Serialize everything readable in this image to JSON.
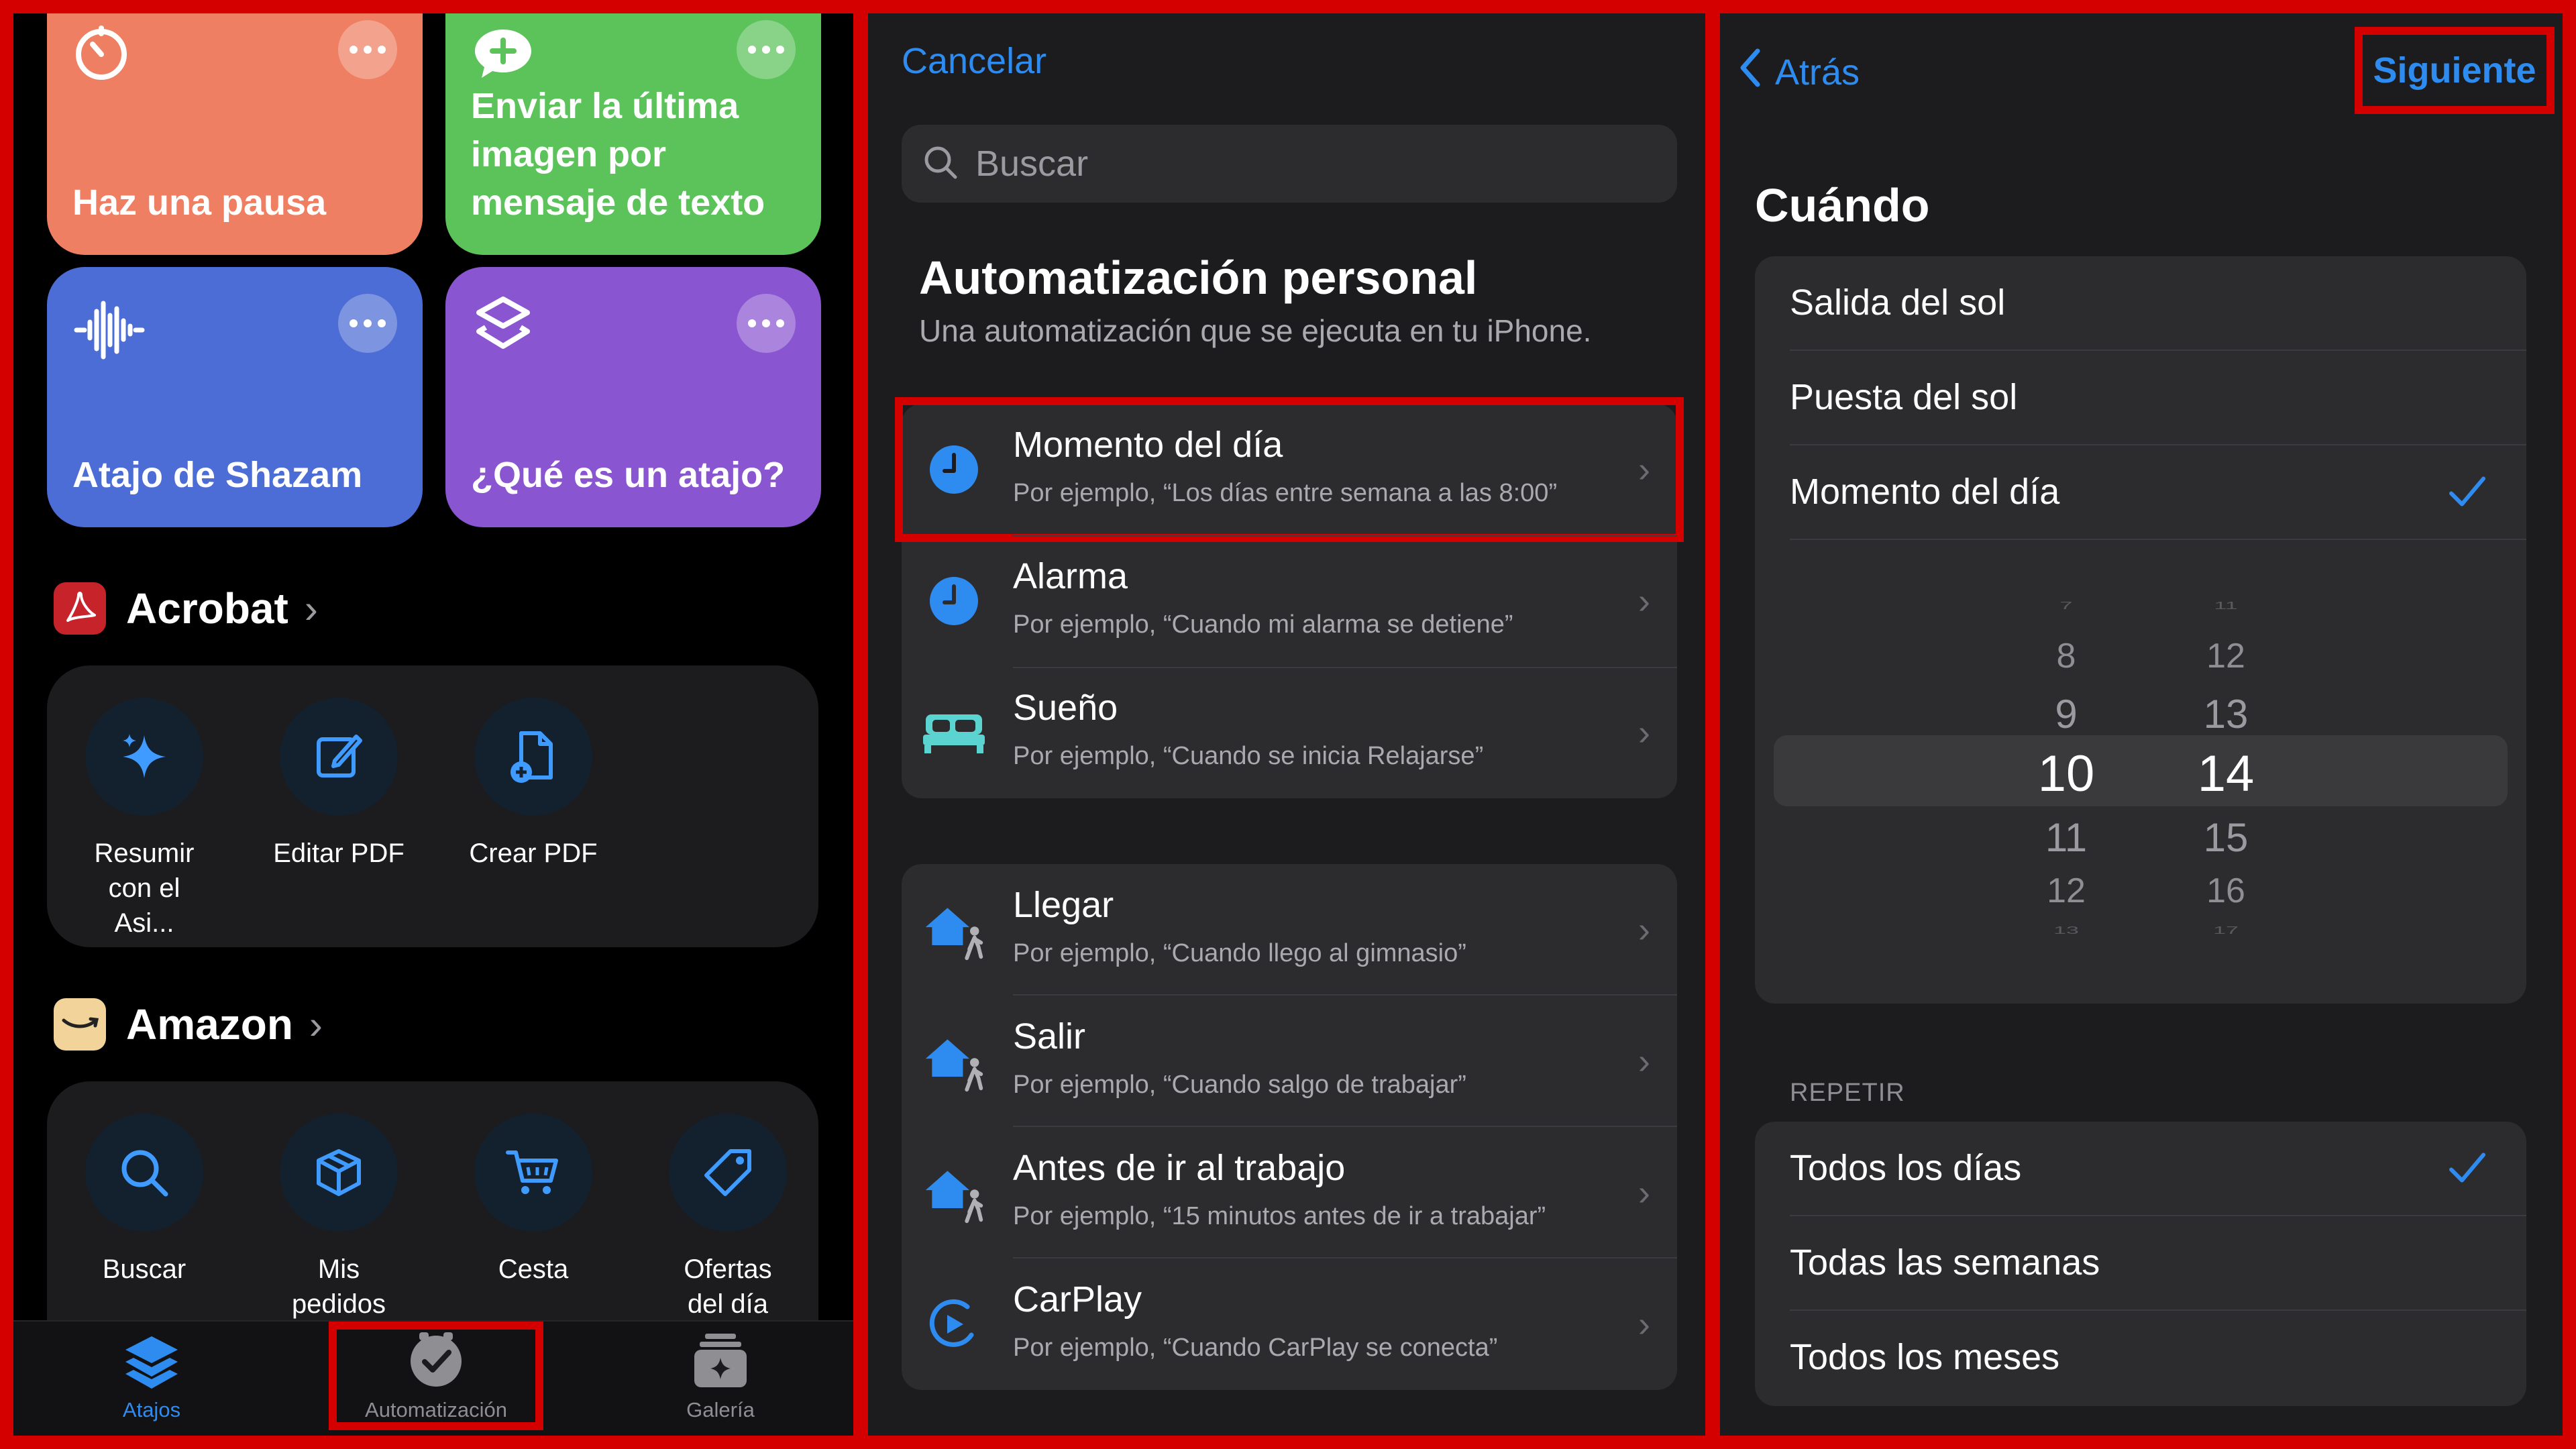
{
  "colors": {
    "accent": "#2e8cf0",
    "highlight": "#d40000"
  },
  "shortcuts_panel": {
    "tiles": [
      {
        "label": "Haz una pausa",
        "icon": "timer-icon",
        "color": "#ee7f62"
      },
      {
        "label": "Enviar la última imagen por mensaje de texto",
        "icon": "message-plus-icon",
        "color": "#5cc35b"
      },
      {
        "label": "Atajo de Shazam",
        "icon": "waveform-icon",
        "color": "#4c6cd6"
      },
      {
        "label": "¿Qué es un atajo?",
        "icon": "shortcuts-icon",
        "color": "#8a55d0"
      }
    ],
    "acrobat": {
      "title": "Acrobat",
      "actions": [
        {
          "label": "Resumir con el Asi...",
          "icon": "sparkles-icon"
        },
        {
          "label": "Editar PDF",
          "icon": "edit-icon"
        },
        {
          "label": "Crear PDF",
          "icon": "create-pdf-icon"
        }
      ]
    },
    "amazon": {
      "title": "Amazon",
      "actions": [
        {
          "label": "Buscar",
          "icon": "search-icon"
        },
        {
          "label": "Mis pedidos",
          "icon": "package-icon"
        },
        {
          "label": "Cesta",
          "icon": "cart-icon"
        },
        {
          "label": "Ofertas del día",
          "icon": "tag-icon"
        }
      ]
    },
    "tabbar": [
      {
        "label": "Atajos",
        "icon": "shortcuts-stack-icon",
        "active": true
      },
      {
        "label": "Automatización",
        "icon": "clock-check-icon",
        "active": false
      },
      {
        "label": "Galería",
        "icon": "gallery-icon",
        "active": false
      }
    ]
  },
  "automation_panel": {
    "cancel_label": "Cancelar",
    "search_placeholder": "Buscar",
    "title": "Automatización personal",
    "subtitle": "Una automatización que se ejecuta en tu iPhone.",
    "group1": [
      {
        "title": "Momento del día",
        "subtitle": "Por ejemplo, “Los días entre semana a las 8:00”",
        "icon": "clock-icon"
      },
      {
        "title": "Alarma",
        "subtitle": "Por ejemplo, “Cuando mi alarma se detiene”",
        "icon": "alarm-clock-icon"
      },
      {
        "title": "Sueño",
        "subtitle": "Por ejemplo, “Cuando se inicia Relajarse”",
        "icon": "bed-icon"
      }
    ],
    "group2": [
      {
        "title": "Llegar",
        "subtitle": "Por ejemplo, “Cuando llego al gimnasio”",
        "icon": "home-arrive-icon"
      },
      {
        "title": "Salir",
        "subtitle": "Por ejemplo, “Cuando salgo de trabajar”",
        "icon": "home-leave-icon"
      },
      {
        "title": "Antes de ir al trabajo",
        "subtitle": "Por ejemplo, “15 minutos antes de ir a trabajar”",
        "icon": "home-commute-icon"
      },
      {
        "title": "CarPlay",
        "subtitle": "Por ejemplo, “Cuando CarPlay se conecta”",
        "icon": "carplay-icon"
      }
    ]
  },
  "when_panel": {
    "back_label": "Atrás",
    "next_label": "Siguiente",
    "title": "Cuándo",
    "options": [
      {
        "label": "Salida del sol",
        "checked": false
      },
      {
        "label": "Puesta del sol",
        "checked": false
      },
      {
        "label": "Momento del día",
        "checked": true
      }
    ],
    "time_picker": {
      "hours": [
        "7",
        "8",
        "9",
        "10",
        "11",
        "12",
        "13"
      ],
      "minutes": [
        "11",
        "12",
        "13",
        "14",
        "15",
        "16",
        "17"
      ],
      "selected_hour": "10",
      "selected_minute": "14"
    },
    "repeat_label": "REPETIR",
    "repeat_options": [
      {
        "label": "Todos los días",
        "checked": true
      },
      {
        "label": "Todas las semanas",
        "checked": false
      },
      {
        "label": "Todos los meses",
        "checked": false
      }
    ]
  }
}
